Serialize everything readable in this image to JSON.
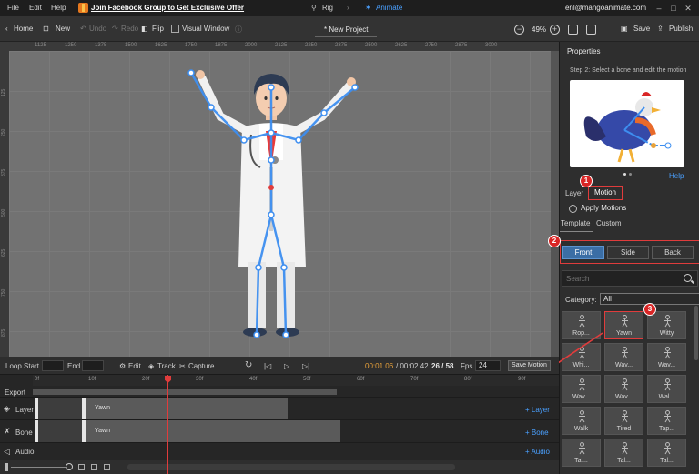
{
  "menu": {
    "file": "File",
    "edit": "Edit",
    "help": "Help",
    "promo": "Join Facebook Group to Get Exclusive Offer",
    "mode_rig": "Rig",
    "mode_animate": "Animate",
    "email": "enl@mangoanimate.com"
  },
  "toolbar": {
    "home": "Home",
    "new": "New",
    "undo": "Undo",
    "redo": "Redo",
    "flip": "Flip",
    "visual_window": "Visual Window",
    "project_title": "* New Project",
    "zoom": "49%",
    "save": "Save",
    "publish": "Publish"
  },
  "ruler": {
    "top_ticks": [
      "1125",
      "1250",
      "1375",
      "1500",
      "1625",
      "1750",
      "1875",
      "2000",
      "2125",
      "2250",
      "2375",
      "2500",
      "2625",
      "2750",
      "2875",
      "3000"
    ],
    "left_ticks": [
      "125",
      "250",
      "375",
      "500",
      "625",
      "750",
      "875"
    ]
  },
  "properties": {
    "title": "Properties",
    "step": "Step 2: Select a bone and edit the motion",
    "help": "Help",
    "tab_layer": "Layer",
    "tab_motion": "Motion",
    "apply_motions": "Apply Motions",
    "subtab_template": "Template",
    "subtab_custom": "Custom",
    "views": [
      "Front",
      "Side",
      "Back"
    ],
    "search_placeholder": "Search",
    "category_label": "Category:",
    "category_value": "All",
    "motions": [
      "Rop...",
      "Yawn",
      "Witty",
      "Whi...",
      "Wav...",
      "Wav...",
      "Wav...",
      "Wav...",
      "Wal...",
      "Walk",
      "Tired",
      "Tap...",
      "Tal...",
      "Tal...",
      "Tal..."
    ],
    "badges": [
      "1",
      "2",
      "3"
    ]
  },
  "timeline": {
    "loop_start": "Loop Start",
    "end": "End",
    "edit": "Edit",
    "track": "Track",
    "capture": "Capture",
    "time_current": "00:01.06",
    "time_total": "/ 00:02.42",
    "frame_count": "26 / 58",
    "fps_label": "Fps",
    "fps_value": "24",
    "save_motion": "Save Motion",
    "frame_ticks": [
      "0f",
      "10f",
      "20f",
      "30f",
      "40f",
      "50f",
      "60f",
      "70f",
      "80f",
      "90f"
    ],
    "export": "Export",
    "layer": "Layer",
    "bone": "Bone",
    "audio": "Audio",
    "add_layer": "+ Layer",
    "add_bone": "+ Bone",
    "add_audio": "+ Audio",
    "clip_layer": "Yawn",
    "clip_bone": "Yawn"
  },
  "colors": {
    "accent_blue": "#3b6ea5",
    "highlight_red": "#e03c3c",
    "time_orange": "#e9a23b",
    "link_blue": "#4aa0ff"
  }
}
